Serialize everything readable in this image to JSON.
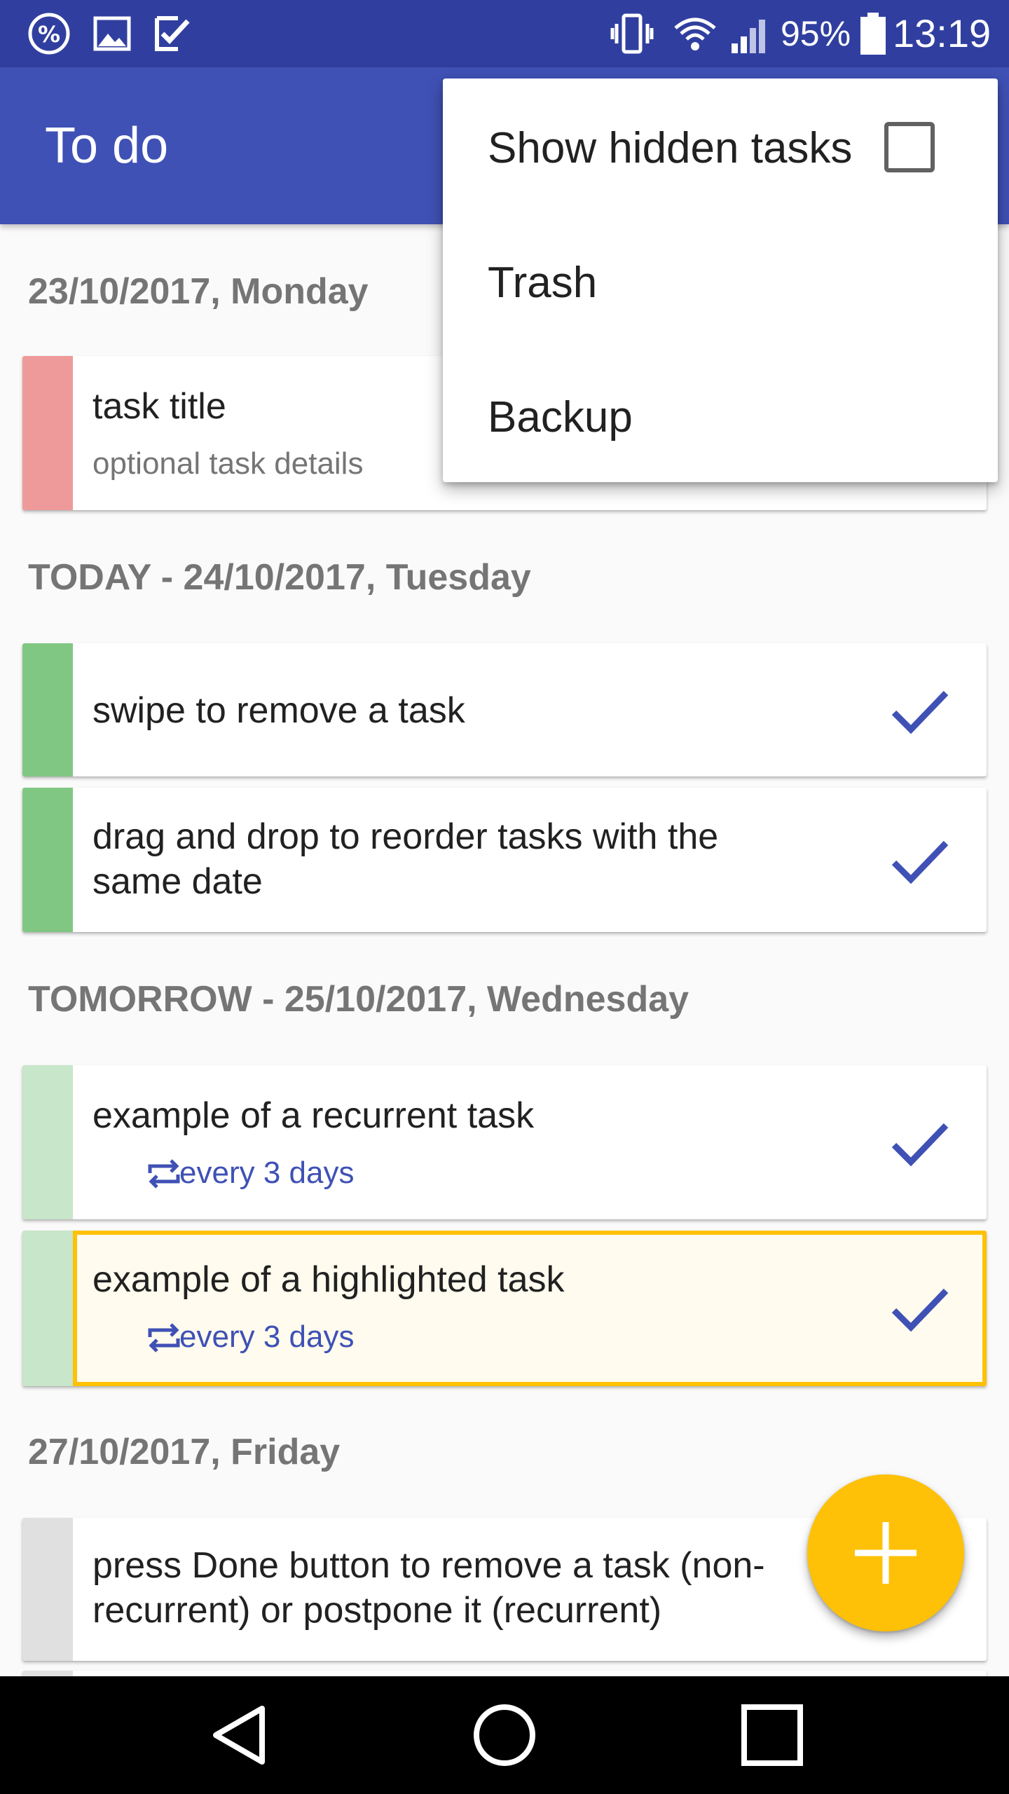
{
  "status_bar": {
    "battery_percent": "95%",
    "time": "13:19",
    "icons": [
      "percent-icon",
      "image-icon",
      "checklist-icon",
      "vibrate-icon",
      "wifi-icon",
      "signal-icon",
      "battery-icon"
    ]
  },
  "app_bar": {
    "title": "To do"
  },
  "sections": [
    {
      "header": "23/10/2017, Monday"
    },
    {
      "header": "TODAY - 24/10/2017, Tuesday"
    },
    {
      "header": "TOMORROW - 25/10/2017, Wednesday"
    },
    {
      "header": "27/10/2017, Friday"
    }
  ],
  "tasks": [
    {
      "title": "task title",
      "details": "optional task details",
      "color": "#EF9A9A"
    },
    {
      "title": "swipe to remove a task",
      "color": "#81C784"
    },
    {
      "title_line1": "drag and drop to reorder tasks with the",
      "title_line2": "same date",
      "color": "#81C784"
    },
    {
      "title": "example of a recurrent task",
      "recurrence": "every 3 days",
      "color": "#C8E6C9"
    },
    {
      "title": "example of a highlighted task",
      "recurrence": "every 3 days",
      "color": "#C8E6C9",
      "highlight_color": "#FFC107"
    },
    {
      "title_line1": "press Done button to remove a task (non-",
      "title_line2": "recurrent) or postpone it (recurrent)",
      "color": "#E0E0E0"
    }
  ],
  "menu": {
    "items": [
      {
        "label": "Show hidden tasks",
        "checked": false
      },
      {
        "label": "Trash"
      },
      {
        "label": "Backup"
      }
    ]
  },
  "fab": {
    "icon": "plus-icon"
  },
  "nav": {
    "icons": [
      "back-icon",
      "home-icon",
      "recents-icon"
    ]
  },
  "colors": {
    "primary": "#3F51B5",
    "primary_dark": "#303F9F",
    "accent": "#FFC107"
  }
}
